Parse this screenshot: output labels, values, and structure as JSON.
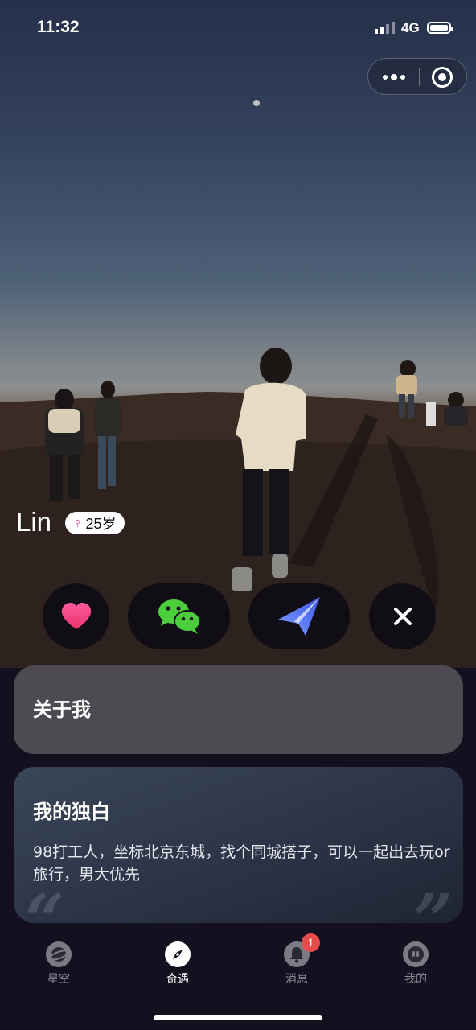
{
  "status_bar": {
    "time": "11:32",
    "network": "4G"
  },
  "mini_program_capsule": {
    "more_icon": "more-dots-icon",
    "close_icon": "target-circle-icon"
  },
  "profile": {
    "name": "Lin",
    "gender_symbol": "♀",
    "age": "25岁"
  },
  "actions": [
    {
      "icon": "heart-icon",
      "color": "#f24b8e"
    },
    {
      "icon": "wechat-icon",
      "color": "#4ccd3c"
    },
    {
      "icon": "paper-plane-icon",
      "color": "#5b7cf7"
    },
    {
      "icon": "close-icon",
      "color": "#ffffff"
    }
  ],
  "about": {
    "title": "关于我"
  },
  "monologue": {
    "title": "我的独白",
    "text": "98打工人，坐标北京东城，找个同城搭子，可以一起出去玩or旅行，男大优先"
  },
  "tabbar": [
    {
      "label": "星空",
      "icon": "planet-icon",
      "active": false
    },
    {
      "label": "奇遇",
      "icon": "compass-icon",
      "active": true
    },
    {
      "label": "消息",
      "icon": "bell-icon",
      "active": false,
      "badge": "1"
    },
    {
      "label": "我的",
      "icon": "profile-face-icon",
      "active": false
    }
  ]
}
